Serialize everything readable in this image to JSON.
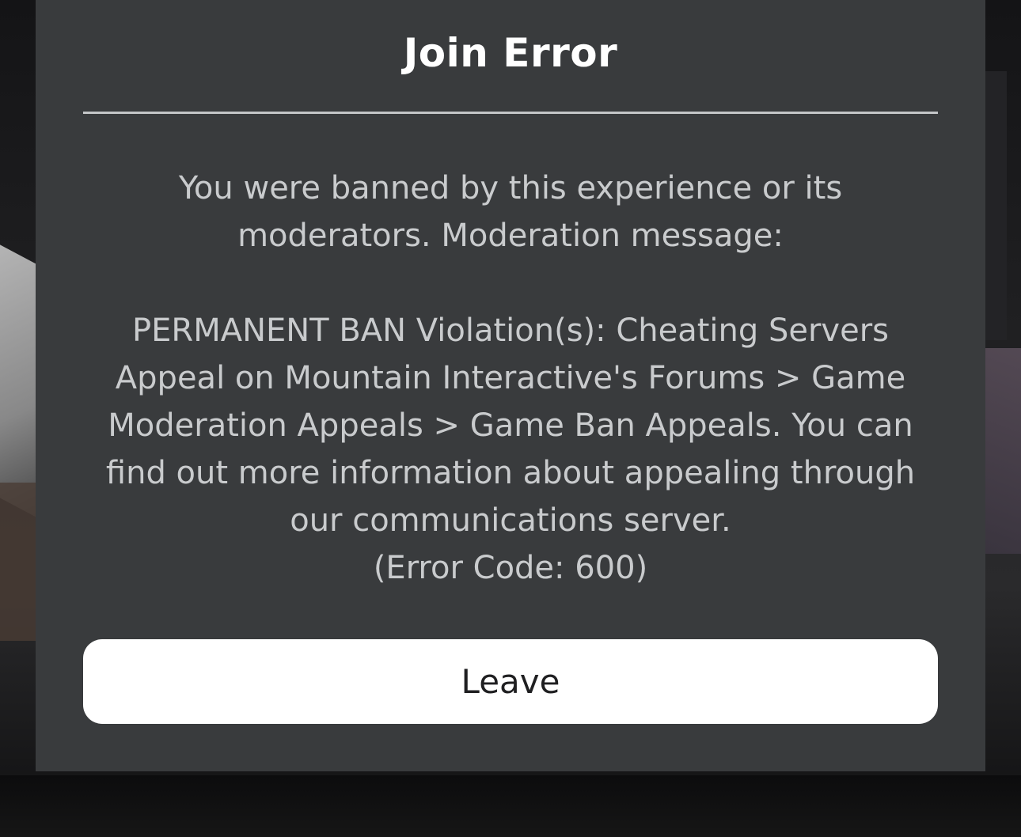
{
  "dialog": {
    "title": "Join Error",
    "message": "You were banned by this experience or its\nmoderators. Moderation message:\n\nPERMANENT BAN Violation(s): Cheating Servers\nAppeal on Mountain Interactive's Forums > Game\nModeration Appeals > Game Ban Appeals. You can\nfind out more information about appealing through\nour communications server.",
    "error_code": "(Error Code: 600)",
    "leave_label": "Leave"
  },
  "colors": {
    "dialog_background": "#393b3d",
    "title_text": "#ffffff",
    "message_text": "#c9cbcd",
    "divider": "#c4c6c8",
    "button_background": "#ffffff",
    "button_text": "#1f1f21"
  }
}
